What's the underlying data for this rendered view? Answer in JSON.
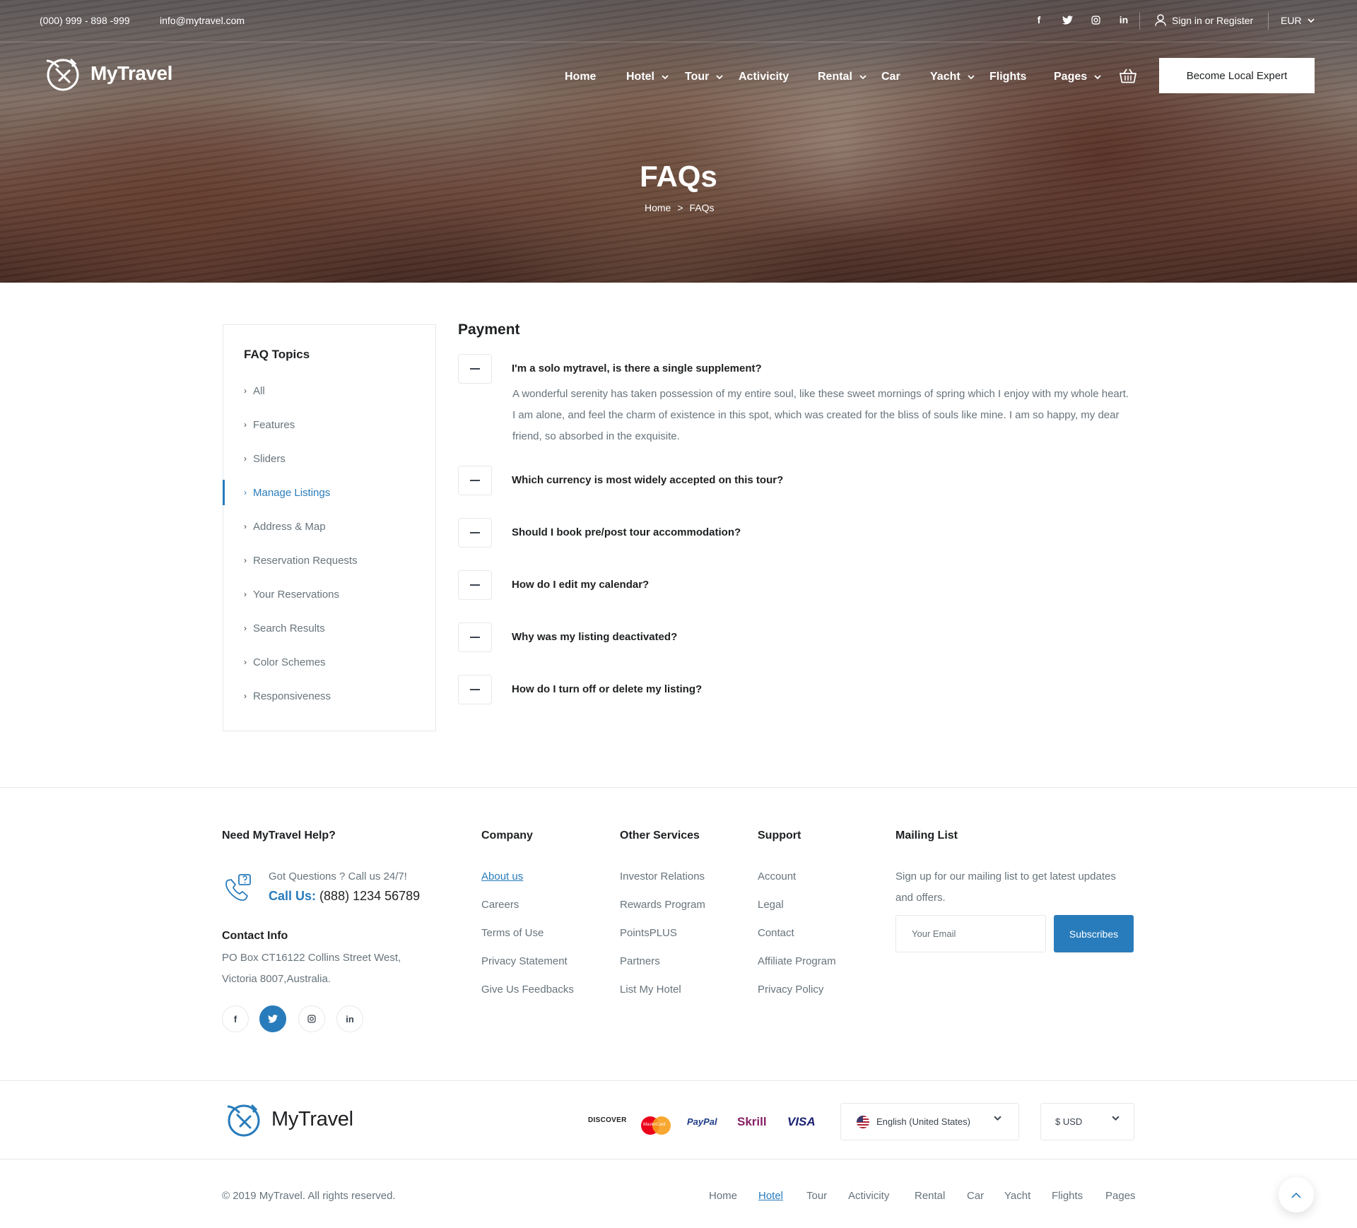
{
  "topbar": {
    "phone": "(000) 999 - 898 -999",
    "email": "info@mytravel.com",
    "socials": [
      "facebook-icon",
      "twitter-icon",
      "instagram-icon",
      "linkedin-icon"
    ],
    "signin": "Sign in or Register",
    "currency": "EUR"
  },
  "navbar": {
    "logo": "MyTravel",
    "menu": [
      "Home",
      "Hotel",
      "Tour",
      "Activicity",
      "Rental",
      "Car",
      "Yacht",
      "Flights",
      "Pages"
    ],
    "cta": "Become Local Expert"
  },
  "hero": {
    "title": "FAQs",
    "breadcrumb": [
      "Home",
      ">",
      "FAQs"
    ]
  },
  "sidebar": {
    "title": "FAQ Topics",
    "topics": [
      "All",
      "Features",
      "Sliders",
      "Manage Listings",
      "Address & Map",
      "Reservation Requests",
      "Your Reservations",
      "Search Results",
      "Color Schemes",
      "Responsiveness"
    ],
    "active": "Manage Listings"
  },
  "faq": {
    "heading": "Payment",
    "items": [
      {
        "question": "I'm a solo mytravel, is there a single supplement?",
        "answer": "A wonderful serenity has taken possession of my entire soul, like these sweet mornings of spring which I enjoy with my whole heart. I am alone, and feel the charm of existence in this spot, which was created for the bliss of souls like mine. I am so happy, my dear friend, so absorbed in the exquisite."
      },
      {
        "question": "Which currency is most widely accepted on this tour?"
      },
      {
        "question": "Should I book pre/post tour accommodation?"
      },
      {
        "question": "How do I edit my calendar?"
      },
      {
        "question": "Why was my listing deactivated?"
      },
      {
        "question": "How do I turn off or delete my listing?"
      }
    ]
  },
  "footer": {
    "help": {
      "title": "Need MyTravel Help?",
      "sub": "Got Questions ? Call us 24/7!",
      "call_label": "Call Us:",
      "call_number": "(888) 1234 56789",
      "contact_title": "Contact Info",
      "address": "PO Box CT16122 Collins Street West, Victoria 8007,Australia.",
      "socials": [
        "facebook-icon",
        "twitter-icon",
        "instagram-icon",
        "linkedin-icon"
      ]
    },
    "company": {
      "title": "Company",
      "links": [
        "About us",
        "Careers",
        "Terms of Use",
        "Privacy Statement",
        "Give Us Feedbacks"
      ]
    },
    "services": {
      "title": "Other Services",
      "links": [
        "Investor Relations",
        "Rewards Program",
        "PointsPLUS",
        "Partners",
        "List My Hotel"
      ]
    },
    "support": {
      "title": "Support",
      "links": [
        "Account",
        "Legal",
        "Contact",
        "Affiliate Program",
        "Privacy Policy"
      ]
    },
    "mailing": {
      "title": "Mailing List",
      "text": "Sign up for our mailing list to get latest updates and offers.",
      "placeholder": "Your Email",
      "button": "Subscribes"
    },
    "logo": "MyTravel",
    "payments": {
      "discover": "DISCOVER",
      "mastercard": "MasterCard",
      "paypal": "PayPal",
      "skrill": "Skrill",
      "visa": "VISA"
    },
    "language": "English (United States)",
    "currency": "$ USD",
    "copyright": "© 2019 MyTravel. All rights reserved.",
    "bottom_nav": [
      "Home",
      "Hotel",
      "Tour",
      "Activicity",
      "Rental",
      "Car",
      "Yacht",
      "Flights",
      "Pages"
    ],
    "bottom_nav_active": "Hotel"
  },
  "colors": {
    "accent": "#297cbb",
    "heading": "#1e2022",
    "text": "#67747c",
    "border": "#e5e8ec"
  }
}
